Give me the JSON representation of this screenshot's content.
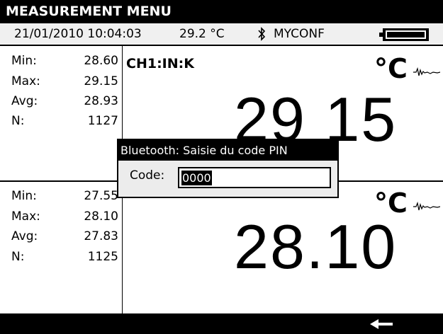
{
  "title": "MEASUREMENT MENU",
  "status": {
    "datetime": "21/01/2010 10:04:03",
    "temperature": "29.2 °C",
    "bluetooth_icon": "bluetooth-icon",
    "config": "MYCONF",
    "battery_icon": "battery-icon"
  },
  "channels": [
    {
      "label": "CH1:IN:K",
      "stats": [
        {
          "label": "Min:",
          "value": "28.60"
        },
        {
          "label": "Max:",
          "value": "29.15"
        },
        {
          "label": "Avg:",
          "value": "28.93"
        },
        {
          "label": "N:",
          "value": "1127"
        }
      ],
      "unit": "°C",
      "reading": "29 15"
    },
    {
      "label": "",
      "stats": [
        {
          "label": "Min:",
          "value": "27.55"
        },
        {
          "label": "Max:",
          "value": "28.10"
        },
        {
          "label": "Avg:",
          "value": "27.83"
        },
        {
          "label": "N:",
          "value": "1125"
        }
      ],
      "unit": "°C",
      "reading": "28.10"
    }
  ],
  "dialog": {
    "title": "Bluetooth: Saisie du code PIN",
    "field_label": "Code:",
    "field_value": "0000"
  },
  "bottombar": {
    "back_icon": "back-arrow-icon"
  }
}
